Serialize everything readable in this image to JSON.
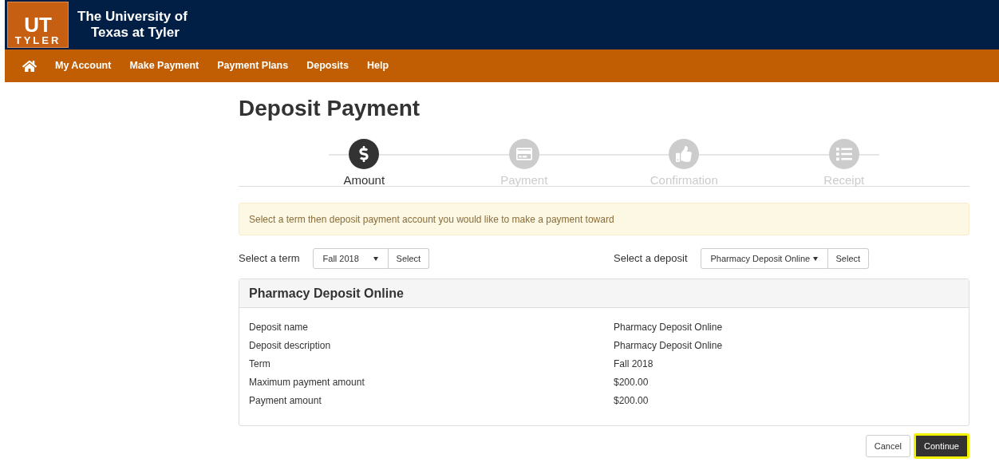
{
  "header": {
    "logo_top": "UT",
    "logo_bottom": "TYLER",
    "title_line1": "The University of",
    "title_line2": "Texas at Tyler"
  },
  "nav": [
    "My Account",
    "Make Payment",
    "Payment Plans",
    "Deposits",
    "Help"
  ],
  "page_title": "Deposit Payment",
  "steps": [
    {
      "label": "Amount",
      "kind": "dollar",
      "selected": true
    },
    {
      "label": "Payment",
      "kind": "card",
      "selected": false
    },
    {
      "label": "Confirmation",
      "kind": "thumb",
      "selected": false
    },
    {
      "label": "Receipt",
      "kind": "list",
      "selected": false
    }
  ],
  "alert": "Select a term then deposit payment account you would like to make a payment toward",
  "term": {
    "label": "Select a term",
    "value": "Fall 2018",
    "button": "Select"
  },
  "deposit": {
    "label": "Select a deposit",
    "value": "Pharmacy Deposit Online",
    "button": "Select"
  },
  "panel": {
    "title": "Pharmacy Deposit Online",
    "rows": [
      {
        "label": "Deposit name",
        "value": "Pharmacy Deposit Online"
      },
      {
        "label": "Deposit description",
        "value": "Pharmacy Deposit Online"
      },
      {
        "label": "Term",
        "value": "Fall 2018"
      },
      {
        "label": "Maximum payment amount",
        "value": "$200.00"
      },
      {
        "label": "Payment amount",
        "value": "$200.00"
      }
    ]
  },
  "buttons": {
    "cancel": "Cancel",
    "continue": "Continue",
    "continue_highlighted": true
  }
}
